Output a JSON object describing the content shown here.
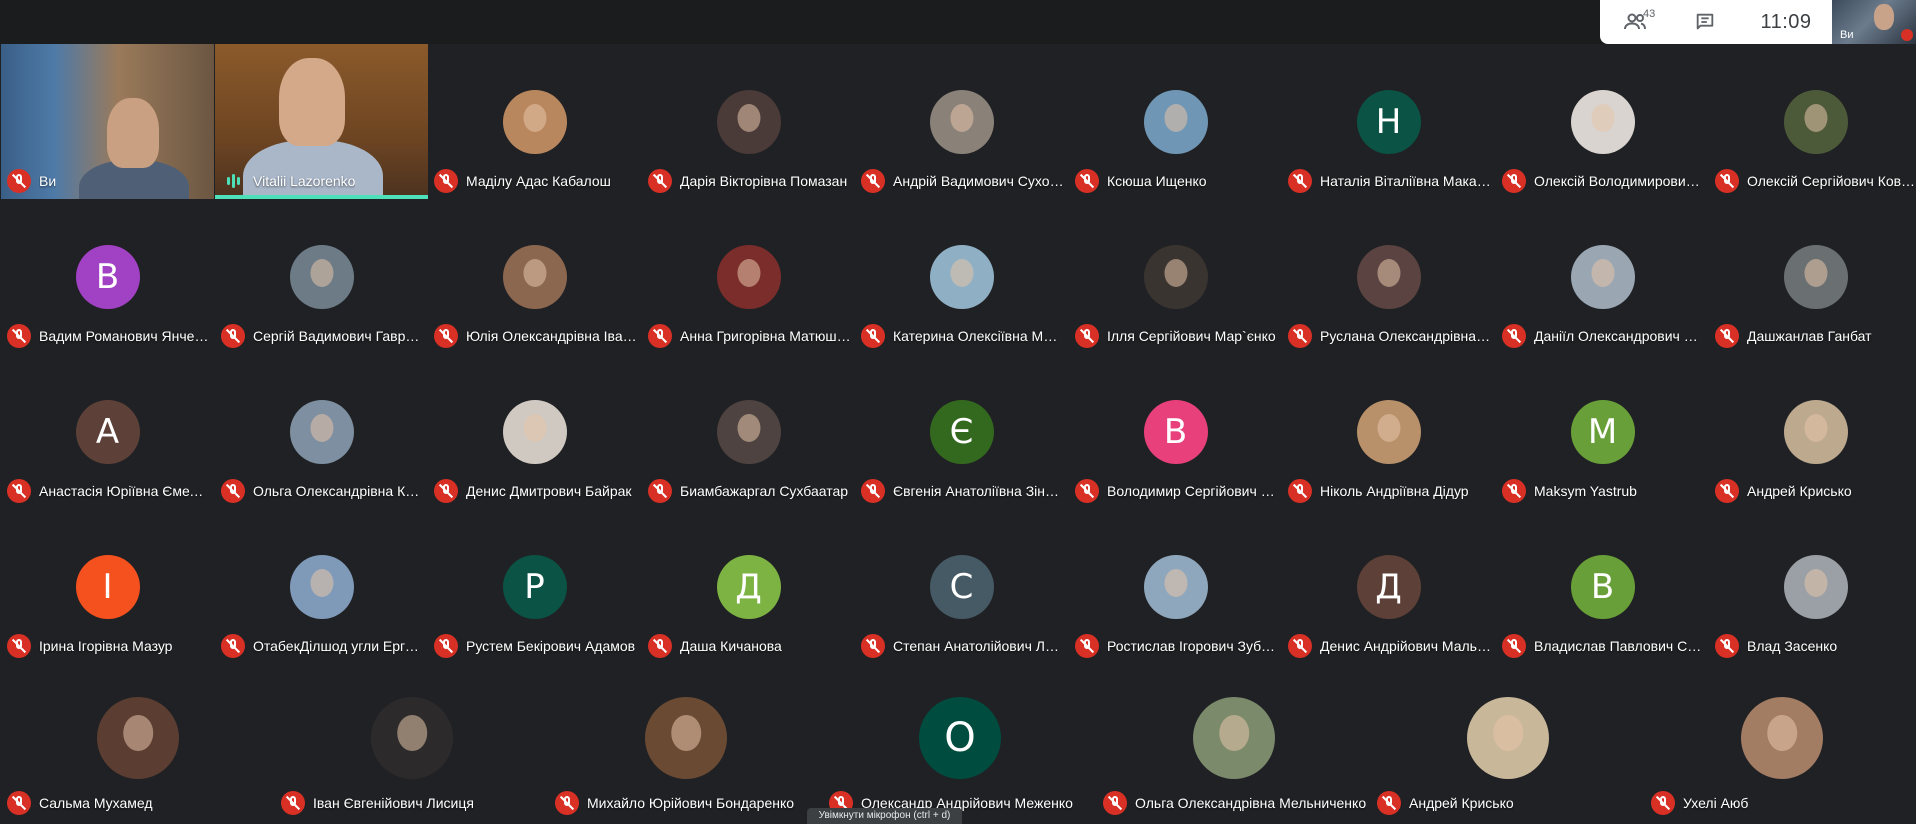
{
  "topbar": {
    "people_count": "43",
    "time": "11:09",
    "self_label": "Ви"
  },
  "tiles": [
    {
      "name": "Ви",
      "type": "video"
    },
    {
      "name": "Vitalii Lazorenko",
      "type": "video",
      "speaking": true
    },
    {
      "name": "Маділу Адас Кабалош",
      "type": "photo",
      "color": "#b9875e"
    },
    {
      "name": "Дарія Вікторівна Помазан",
      "type": "photo",
      "color": "#4a3a38"
    },
    {
      "name": "Андрій Вадимович Сухоруков",
      "type": "photo",
      "color": "#8a8178"
    },
    {
      "name": "Ксюша Ищенко",
      "type": "photo",
      "color": "#6f96b4"
    },
    {
      "name": "Наталія Віталіївна Макаренко",
      "type": "letter",
      "letter": "Н",
      "color": "#0b5345"
    },
    {
      "name": "Олексій Володимирович Петренко",
      "type": "photo",
      "color": "#d9d4cf"
    },
    {
      "name": "Олексій Сергійович Коваленко",
      "type": "photo",
      "color": "#4d5a3a"
    },
    {
      "name": "Вадим Романович Янченко",
      "type": "letter",
      "letter": "В",
      "color": "#a142c4"
    },
    {
      "name": "Сергій Вадимович Гавриленко",
      "type": "photo",
      "color": "#6c7b86"
    },
    {
      "name": "Юлія Олександрівна Іваненко",
      "type": "photo",
      "color": "#8b6750"
    },
    {
      "name": "Анна Григорівна Матюшенко",
      "type": "photo",
      "color": "#7a2d2a"
    },
    {
      "name": "Катерина Олексіївна Мельник",
      "type": "photo",
      "color": "#8fb0c4"
    },
    {
      "name": "Ілля Сергійович Мар`єнко",
      "type": "photo",
      "color": "#3a3431"
    },
    {
      "name": "Руслана Олександрівна Бондар",
      "type": "photo",
      "color": "#5a4340"
    },
    {
      "name": "Даніїл Олександрович Шевченко",
      "type": "photo",
      "color": "#9aa6b2"
    },
    {
      "name": "Дашжанлав Ганбат",
      "type": "photo",
      "color": "#6a6f72"
    },
    {
      "name": "Анастасія Юріївна Ємельяненко",
      "type": "letter",
      "letter": "А",
      "color": "#5d4037"
    },
    {
      "name": "Ольга Олександрівна Кравченко",
      "type": "photo",
      "color": "#7d8fa0"
    },
    {
      "name": "Денис Дмитрович Байрак",
      "type": "photo",
      "color": "#cfc9c2"
    },
    {
      "name": "Биамбажаргал Сухбаатар",
      "type": "photo",
      "color": "#4e4340"
    },
    {
      "name": "Євгенія Анатоліївна Зінченко",
      "type": "letter",
      "letter": "Є",
      "color": "#33691e"
    },
    {
      "name": "Володимир Сергійович Ткаченко",
      "type": "letter",
      "letter": "В",
      "color": "#e8407a"
    },
    {
      "name": "Ніколь Андріївна Дідур",
      "type": "photo",
      "color": "#b8906a"
    },
    {
      "name": "Maksym Yastrub",
      "type": "letter",
      "letter": "M",
      "color": "#689f38"
    },
    {
      "name": "Андрей Крисько",
      "type": "photo",
      "color": "#bca98e"
    },
    {
      "name": "Ірина Ігорівна Мазур",
      "type": "letter",
      "letter": "І",
      "color": "#f4511e"
    },
    {
      "name": "ОтабекДілшод угли Ергашев",
      "type": "photo",
      "color": "#7e9ab8"
    },
    {
      "name": "Рустем Бекірович Адамов",
      "type": "letter",
      "letter": "Р",
      "color": "#0b5345"
    },
    {
      "name": "Даша Кичанова",
      "type": "letter",
      "letter": "Д",
      "color": "#7cb342"
    },
    {
      "name": "Степан Анатолійович Литвиненко",
      "type": "letter",
      "letter": "С",
      "color": "#455a64"
    },
    {
      "name": "Ростислав Ігорович Зубенко",
      "type": "photo",
      "color": "#8fa7bc"
    },
    {
      "name": "Денис Андрійович Мальцев",
      "type": "letter",
      "letter": "Д",
      "color": "#5d4037"
    },
    {
      "name": "Владислав Павлович Сидоренко",
      "type": "letter",
      "letter": "В",
      "color": "#689f38"
    },
    {
      "name": "Влад Засенко",
      "type": "photo",
      "color": "#9aa0a6"
    }
  ],
  "last_row": [
    {
      "name": "Сальма Мухамед",
      "type": "photo",
      "color": "#5b3d31"
    },
    {
      "name": "Іван Євгенійович Лисиця",
      "type": "photo",
      "color": "#2c2a2b"
    },
    {
      "name": "Михайло Юрійович Бондаренко",
      "type": "photo",
      "color": "#6a4a33"
    },
    {
      "name": "Олександр Андрійович Меженко",
      "type": "letter",
      "letter": "О",
      "color": "#004d40"
    },
    {
      "name": "Ольга Олександрівна Мельниченко",
      "type": "photo",
      "color": "#7b8a6a"
    },
    {
      "name": "Андрей Крисько",
      "type": "photo",
      "color": "#c9b79a"
    },
    {
      "name": "Ухелі Аюб",
      "type": "photo",
      "color": "#a37c64"
    }
  ],
  "tooltip_text": "Увімкнути мікрофон (ctrl + d)"
}
